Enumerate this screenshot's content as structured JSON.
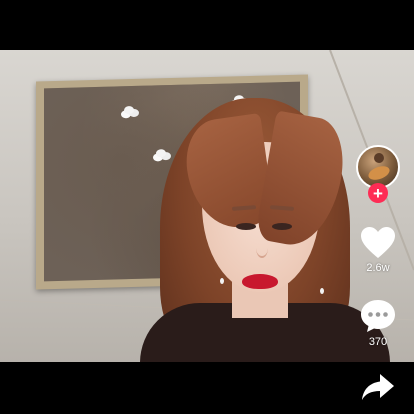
{
  "actions": {
    "like_count": "2.6w",
    "comment_count": "370",
    "share_count": "",
    "follow_symbol": "+"
  },
  "icons": {
    "like": "heart-icon",
    "comment": "chat-bubble-icon",
    "share": "share-arrow-icon",
    "follow": "plus-icon"
  },
  "colors": {
    "background": "#000000",
    "follow_button": "#fe2c55",
    "icon": "#ffffff",
    "lipstick": "#c8182e"
  }
}
